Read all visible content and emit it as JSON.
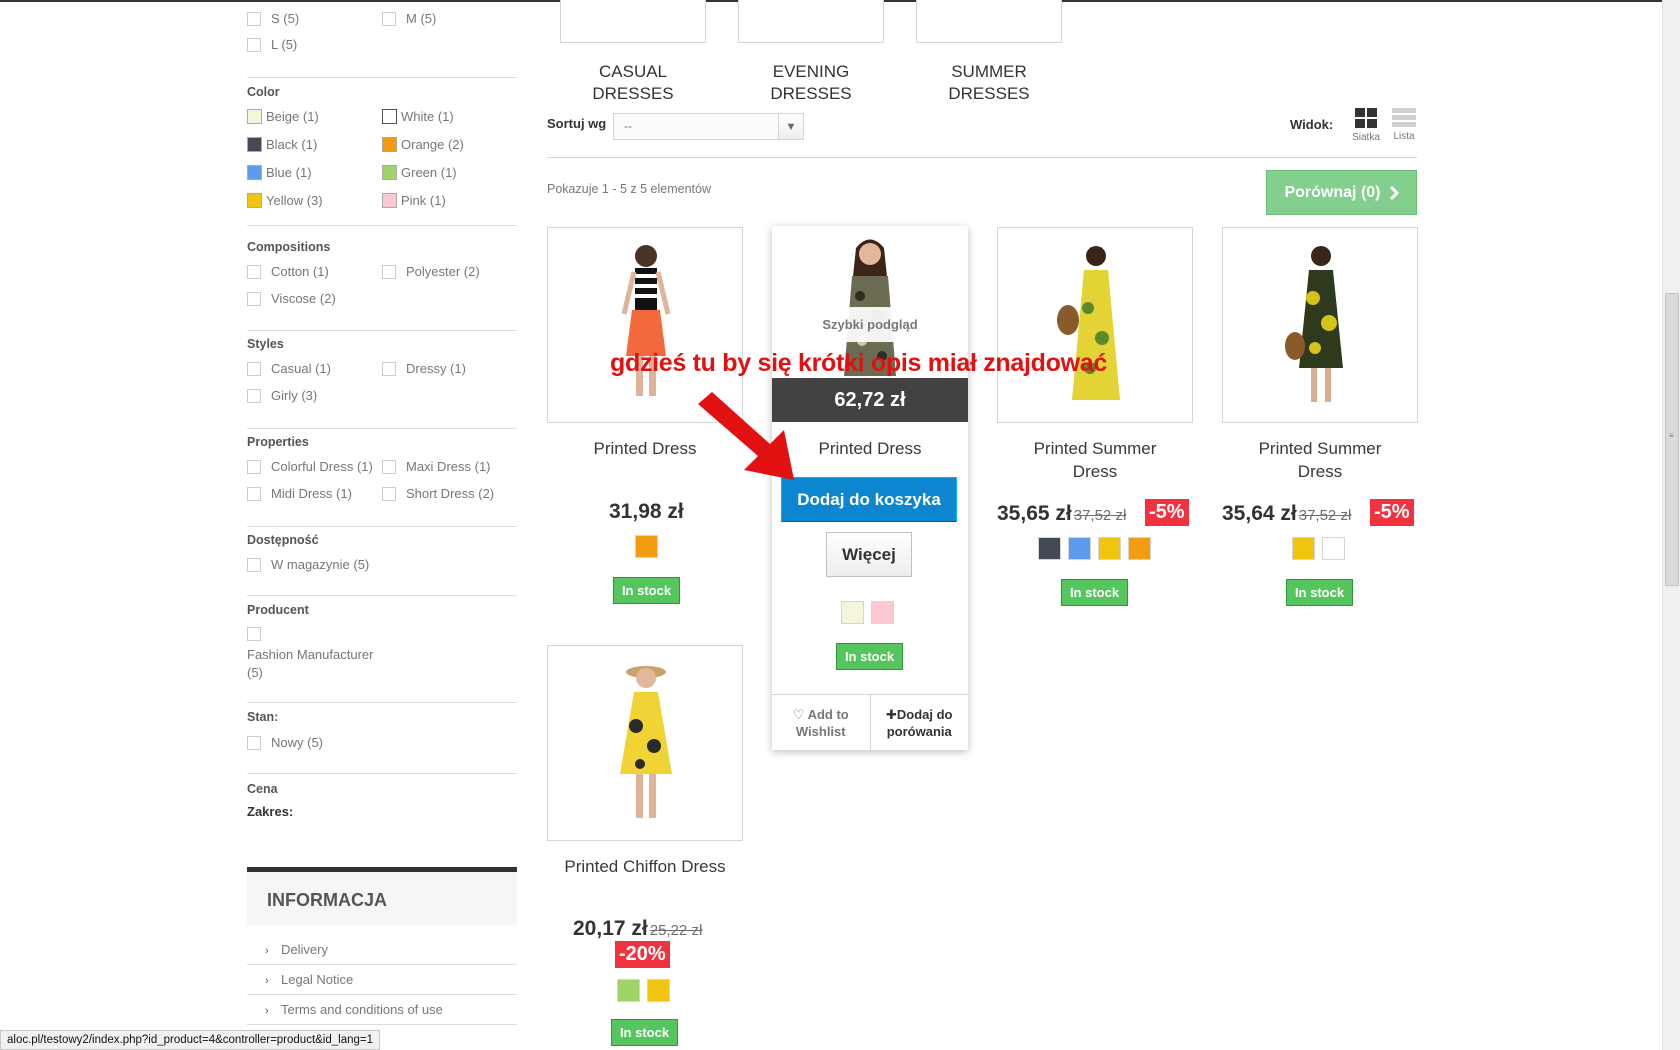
{
  "filters": {
    "size_items": [
      {
        "label": "S (5)"
      },
      {
        "label": "M (5)"
      },
      {
        "label": "L (5)"
      }
    ],
    "color": {
      "title": "Color",
      "items": [
        {
          "label": "Beige (1)",
          "hex": "#f5f5dc"
        },
        {
          "label": "White (1)",
          "hex": "#ffffff"
        },
        {
          "label": "Black (1)",
          "hex": "#434a54"
        },
        {
          "label": "Orange (2)",
          "hex": "#f39c11"
        },
        {
          "label": "Blue (1)",
          "hex": "#5d9cec"
        },
        {
          "label": "Green (1)",
          "hex": "#a0d468"
        },
        {
          "label": "Yellow (3)",
          "hex": "#f1c40f"
        },
        {
          "label": "Pink (1)",
          "hex": "#fcc8d1"
        }
      ]
    },
    "compositions": {
      "title": "Compositions",
      "items": [
        {
          "label": "Cotton (1)"
        },
        {
          "label": "Polyester (2)"
        },
        {
          "label": "Viscose (2)"
        }
      ]
    },
    "styles": {
      "title": "Styles",
      "items": [
        {
          "label": "Casual (1)"
        },
        {
          "label": "Dressy (1)"
        },
        {
          "label": "Girly (3)"
        }
      ]
    },
    "properties": {
      "title": "Properties",
      "items": [
        {
          "label": "Colorful Dress (1)"
        },
        {
          "label": "Maxi Dress (1)"
        },
        {
          "label": "Midi Dress (1)"
        },
        {
          "label": "Short Dress (2)"
        }
      ]
    },
    "availability": {
      "title": "Dostępność",
      "items": [
        {
          "label": "W magazynie (5)"
        }
      ]
    },
    "manufacturer": {
      "title": "Producent",
      "items": [
        {
          "label_line1": "Fashion Manufacturer",
          "label_line2": "(5)"
        }
      ]
    },
    "condition": {
      "title": "Stan:",
      "items": [
        {
          "label": "Nowy (5)"
        }
      ]
    },
    "price": {
      "title": "Cena",
      "range_label": "Zakres:"
    }
  },
  "info": {
    "title": "INFORMACJA",
    "links": [
      {
        "label": "Delivery"
      },
      {
        "label": "Legal Notice"
      },
      {
        "label": "Terms and conditions of use"
      }
    ]
  },
  "categories": [
    {
      "line1": "CASUAL",
      "line2": "DRESSES"
    },
    {
      "line1": "EVENING",
      "line2": "DRESSES"
    },
    {
      "line1": "SUMMER",
      "line2": "DRESSES"
    }
  ],
  "toolbar": {
    "sort_label": "Sortuj wg",
    "sort_value": "--",
    "view_label": "Widok:",
    "view_grid": "Siatka",
    "view_list": "Lista",
    "showing": "Pokazuje 1 - 5 z 5 elementów",
    "compare_label": "Porównaj (0)"
  },
  "products": [
    {
      "name": "Printed Dress",
      "price": "31,98 zł",
      "stock": "In stock",
      "colors": [
        "#f39c11"
      ]
    },
    {
      "name": "Printed Dress",
      "price": "62,72 zł",
      "stock": "In stock",
      "colors": [
        "#f5f5dc",
        "#fcc8d1"
      ],
      "quick_view": "Szybki podgląd",
      "add_to_cart": "Dodaj do koszyka",
      "more": "Więcej",
      "wishlist_line1": "Add to",
      "wishlist_line2": "Wishlist",
      "compare_line1": "Dodaj do",
      "compare_line2": "porówania"
    },
    {
      "name_line1": "Printed Summer",
      "name_line2": "Dress",
      "price": "35,65 zł",
      "old_price": "37,52 zł",
      "reduction": "-5%",
      "stock": "In stock",
      "colors": [
        "#434a54",
        "#5d9cec",
        "#f1c40f",
        "#f39c11"
      ]
    },
    {
      "name_line1": "Printed Summer",
      "name_line2": "Dress",
      "price": "35,64 zł",
      "old_price": "37,52 zł",
      "reduction": "-5%",
      "stock": "In stock",
      "colors": [
        "#f1c40f",
        "#ffffff"
      ]
    },
    {
      "name": "Printed Chiffon Dress",
      "price": "20,17 zł",
      "old_price": "25,22 zł",
      "reduction": "-20%",
      "stock": "In stock",
      "colors": [
        "#a0d468",
        "#f1c40f"
      ]
    }
  ],
  "annotation": "gdzieś tu by się krótki opis miał znajdować",
  "status_url": "aloc.pl/testowy2/index.php?id_product=4&controller=product&id_lang=1"
}
